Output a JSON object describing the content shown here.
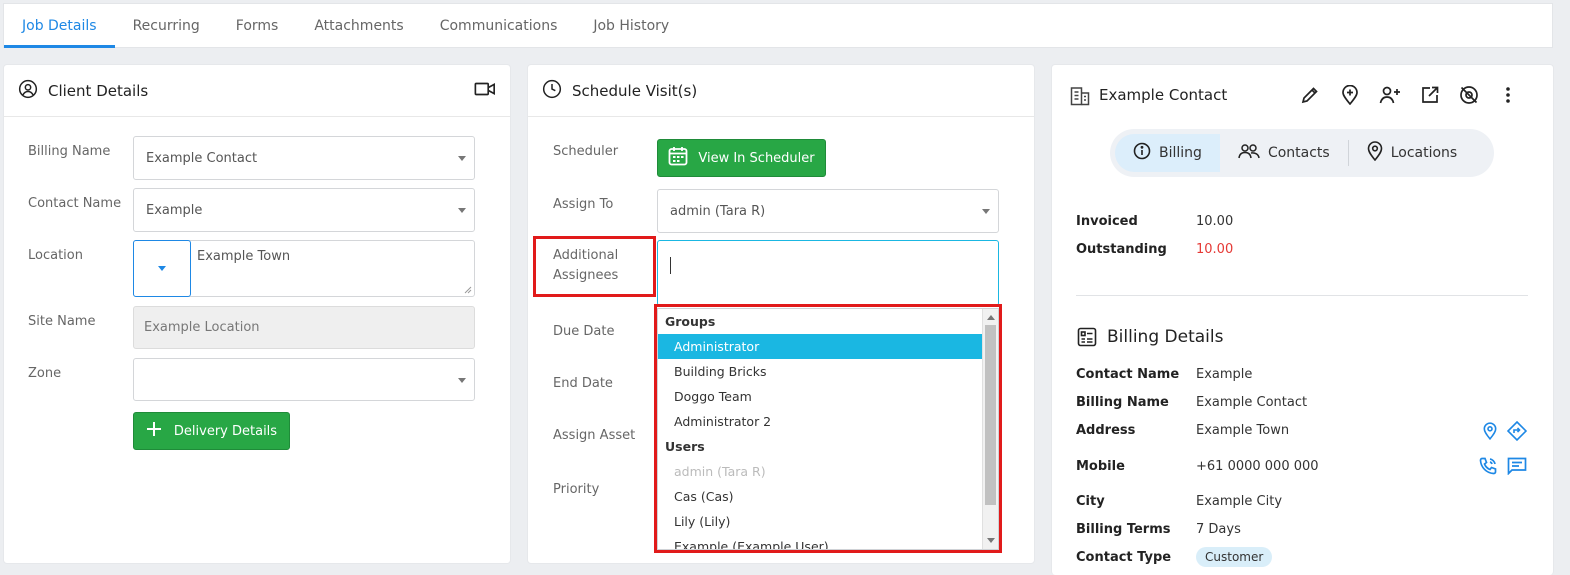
{
  "tabs": [
    "Job Details",
    "Recurring",
    "Forms",
    "Attachments",
    "Communications",
    "Job History"
  ],
  "client": {
    "title": "Client Details",
    "billing_name_label": "Billing Name",
    "billing_name_value": "Example Contact",
    "contact_name_label": "Contact Name",
    "contact_name_value": "Example",
    "location_label": "Location",
    "location_value": "Example Town",
    "site_name_label": "Site Name",
    "site_name_value": "Example Location",
    "zone_label": "Zone",
    "zone_value": "",
    "delivery_button": "Delivery Details"
  },
  "schedule": {
    "title": "Schedule Visit(s)",
    "scheduler_label": "Scheduler",
    "view_button": "View In Scheduler",
    "assign_to_label": "Assign To",
    "assign_to_value": "admin (Tara R)",
    "additional_label_1": "Additional",
    "additional_label_2": "Assignees",
    "due_date_label": "Due Date",
    "end_date_label": "End Date",
    "assign_asset_label": "Assign Asset",
    "priority_label": "Priority"
  },
  "dropdown": {
    "groups_header": "Groups",
    "groups": [
      "Administrator",
      "Building Bricks",
      "Doggo Team",
      "Administrator 2"
    ],
    "users_header": "Users",
    "users": [
      "admin (Tara R)",
      "Cas (Cas)",
      "Lily (Lily)",
      "Example (Example User)"
    ]
  },
  "contact": {
    "title": "Example Contact",
    "seg_billing": "Billing",
    "seg_contacts": "Contacts",
    "seg_locations": "Locations",
    "invoiced_label": "Invoiced",
    "invoiced_value": "10.00",
    "outstanding_label": "Outstanding",
    "outstanding_value": "10.00",
    "billing_details_title": "Billing Details",
    "contact_name_label": "Contact Name",
    "contact_name_value": "Example",
    "billing_name_label": "Billing Name",
    "billing_name_value": "Example Contact",
    "address_label": "Address",
    "address_value": "Example Town",
    "mobile_label": "Mobile",
    "mobile_value": "+61 0000 000 000",
    "city_label": "City",
    "city_value": "Example City",
    "billing_terms_label": "Billing Terms",
    "billing_terms_value": "7 Days",
    "contact_type_label": "Contact Type",
    "contact_type_value": "Customer"
  },
  "colors": {
    "accent": "#1e88e5",
    "green": "#28a745",
    "highlight": "#1ab7e2",
    "outstanding": "#e53935",
    "annotation": "#e11a1a"
  }
}
